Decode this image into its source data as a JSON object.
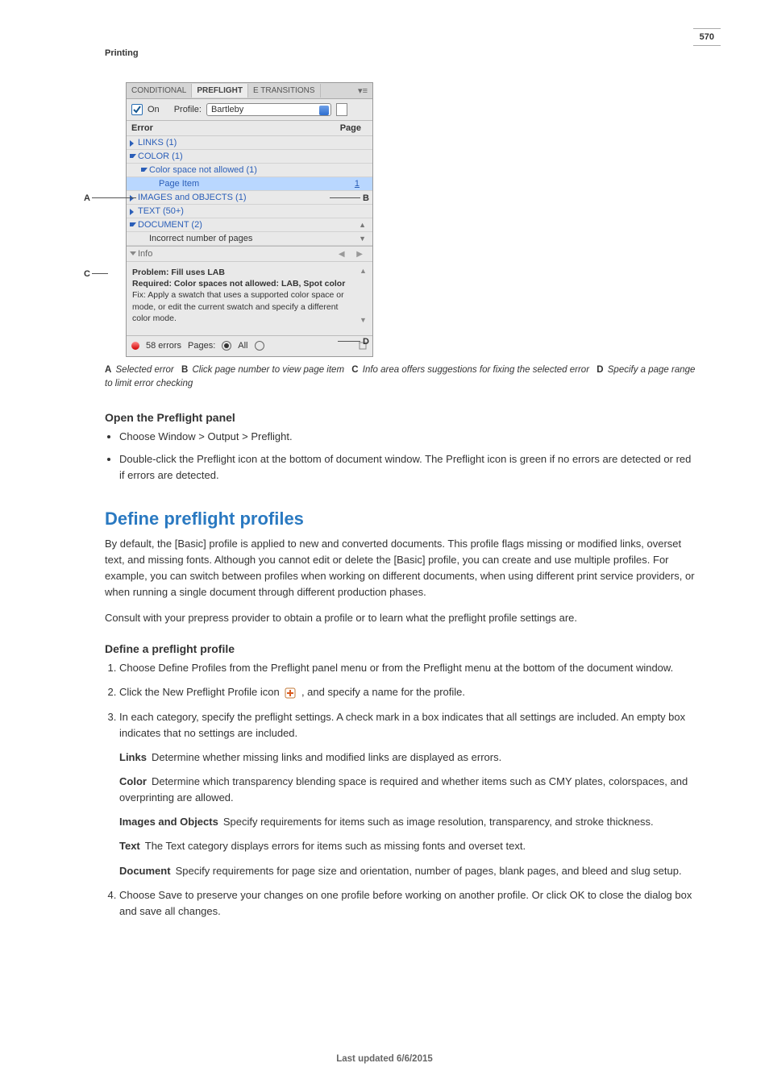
{
  "page_number": "570",
  "chapter": "Printing",
  "panel": {
    "tabs": {
      "conditional": "CONDITIONAL",
      "preflight": "PREFLIGHT",
      "transitions": "E TRANSITIONS"
    },
    "on_label": "On",
    "profile_label": "Profile:",
    "profile_value": "Bartleby",
    "header_error": "Error",
    "header_page": "Page",
    "rows": {
      "links": "LINKS (1)",
      "color": "COLOR (1)",
      "color_space": "Color space not allowed (1)",
      "page_item": "Page Item",
      "page_item_page": "1",
      "images": "IMAGES and OBJECTS (1)",
      "text": "TEXT (50+)",
      "document": "DOCUMENT (2)",
      "doc_pages": "Incorrect number of pages"
    },
    "info_label": "Info",
    "info": {
      "problem": "Problem: Fill uses LAB",
      "required": "Required: Color spaces not allowed: LAB, Spot color",
      "fix": "Fix: Apply a swatch that uses a supported color space or mode, or edit the current swatch and specify a different color mode."
    },
    "status": {
      "errors": "58 errors",
      "pages_label": "Pages:",
      "all_label": "All"
    }
  },
  "figcaption": {
    "a": "Selected error",
    "b": "Click page number to view page item",
    "c": "Info area offers suggestions for fixing the selected error",
    "d": "Specify a page range to limit error checking"
  },
  "sec_open": {
    "heading": "Open the Preflight panel",
    "b1": "Choose Window > Output > Preflight.",
    "b2": "Double-click the Preflight icon at the bottom of document window. The Preflight icon is green if no errors are detected or red if errors are detected."
  },
  "sec_define": {
    "heading": "Define preflight profiles",
    "p1": "By default, the [Basic] profile is applied to new and converted documents. This profile flags missing or modified links, overset text, and missing fonts. Although you cannot edit or delete the [Basic] profile, you can create and use multiple profiles. For example, you can switch between profiles when working on different documents, when using different print service providers, or when running a single document through different production phases.",
    "p2": "Consult with your prepress provider to obtain a profile or to learn what the preflight profile settings are."
  },
  "sec_define_profile": {
    "heading": "Define a preflight profile",
    "s1": "Choose Define Profiles from the Preflight panel menu or from the Preflight menu at the bottom of the document window.",
    "s2a": "Click the New Preflight Profile icon ",
    "s2b": ", and specify a name for the profile.",
    "s3": "In each category, specify the preflight settings. A check mark in a box indicates that all settings are included. An empty box indicates that no settings are included.",
    "links_term": "Links",
    "links_desc": "Determine whether missing links and modified links are displayed as errors.",
    "color_term": "Color",
    "color_desc": "Determine which transparency blending space is required and whether items such as CMY plates, colorspaces, and overprinting are allowed.",
    "img_term": "Images and Objects",
    "img_desc": "Specify requirements for items such as image resolution, transparency, and stroke thickness.",
    "text_term": "Text",
    "text_desc": "The Text category displays errors for items such as missing fonts and overset text.",
    "doc_term": "Document",
    "doc_desc": "Specify requirements for page size and orientation, number of pages, blank pages, and bleed and slug setup.",
    "s4": "Choose Save to preserve your changes on one profile before working on another profile. Or click OK to close the dialog box and save all changes."
  },
  "footer": "Last updated 6/6/2015",
  "callout_labels": {
    "a": "A",
    "b": "B",
    "c": "C",
    "d": "D"
  }
}
